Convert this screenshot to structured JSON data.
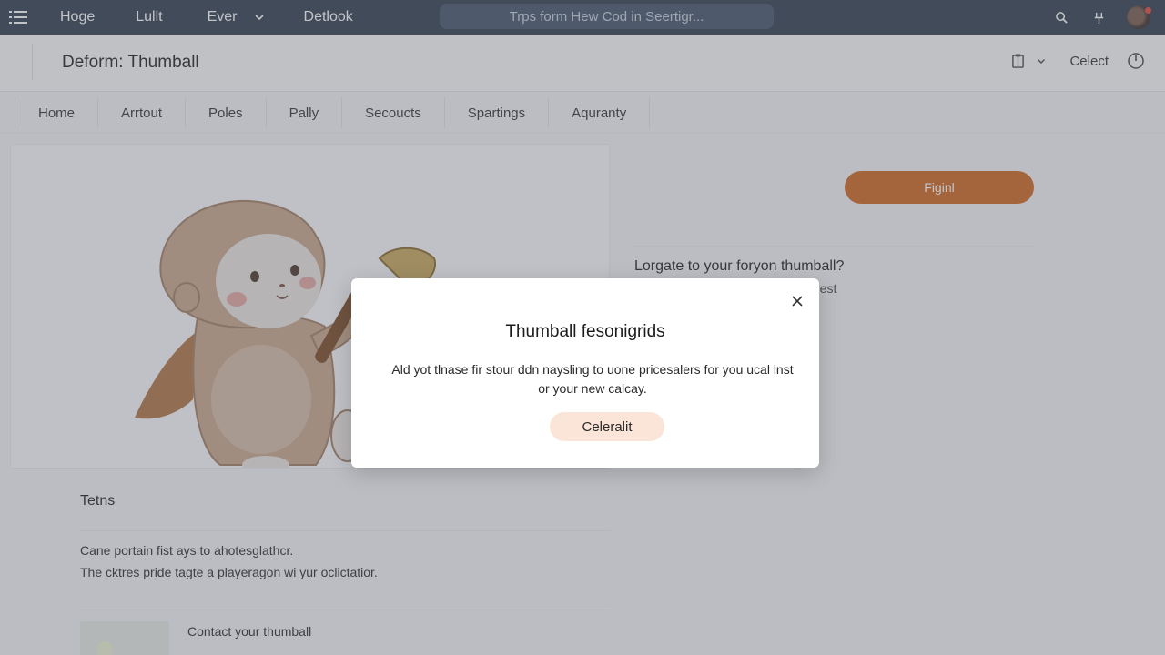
{
  "topbar": {
    "nav": [
      "Hoge",
      "Lullt",
      "Ever",
      "Detlook"
    ],
    "search_placeholder": "Trps form Hew Cod in Seertigr...",
    "icons": [
      "menu-icon",
      "chevron-down-icon",
      "search-icon",
      "pin-icon",
      "avatar"
    ]
  },
  "header": {
    "title": "Deform: Thumball",
    "select_label": "Celect"
  },
  "tabs": [
    "Home",
    "Arrtout",
    "Poles",
    "Pally",
    "Secoucts",
    "Spartings",
    "Aquranty"
  ],
  "right_panel": {
    "button_label": "Figinl",
    "title": "Lorgate to your foryon thumball?",
    "subtitle": "rest"
  },
  "terms": {
    "title": "Tetns",
    "line1": "Cane portain fist ays to ahotesglathcr.",
    "line2": "The cktres pride tagte a playeragon wi yur oclictatior.",
    "contact": "Contact your thumball"
  },
  "modal": {
    "title": "Thumball fesonigrids",
    "body": "Ald yot tlnase fir stour ddn naysling to uone pricesalers for you ucal lnst or your new calcay.",
    "button_label": "Celeralit"
  },
  "colors": {
    "topbar": "#2f3d4d",
    "accent": "#d0671e",
    "modal_button": "#fbe5d8"
  }
}
